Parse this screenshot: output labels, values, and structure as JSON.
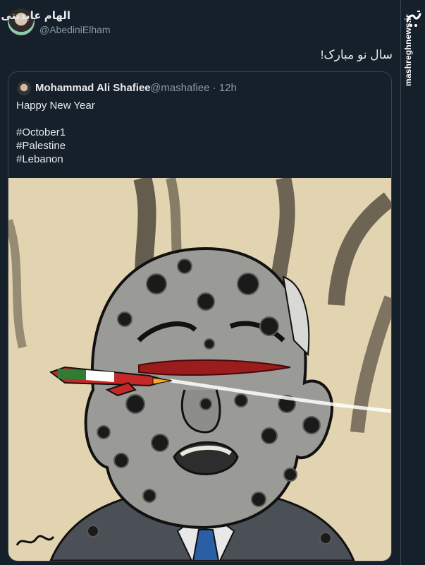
{
  "author": {
    "display_name": "الهام عابدینی",
    "handle": "@AbediniElham"
  },
  "tweet": {
    "text": "سال نو مبارک!"
  },
  "quoted_tweet": {
    "author_name": "Mohammad Ali Shafiee",
    "handle": "@mashafiee",
    "separator": "·",
    "time": "12h",
    "lines": [
      "Happy New Year",
      "#October1",
      "#Palestine",
      "#Lebanon"
    ],
    "image": {
      "description_icon": "cartoon-illustration",
      "missile_label": ""
    }
  },
  "watermark": {
    "site": "mashreghnews.ir",
    "logo_icon": "mashregh-logo"
  },
  "colors": {
    "background": "#15202b",
    "border": "#38444d",
    "secondary_text": "#8b98a5",
    "primary_text": "#e7e9ea"
  }
}
